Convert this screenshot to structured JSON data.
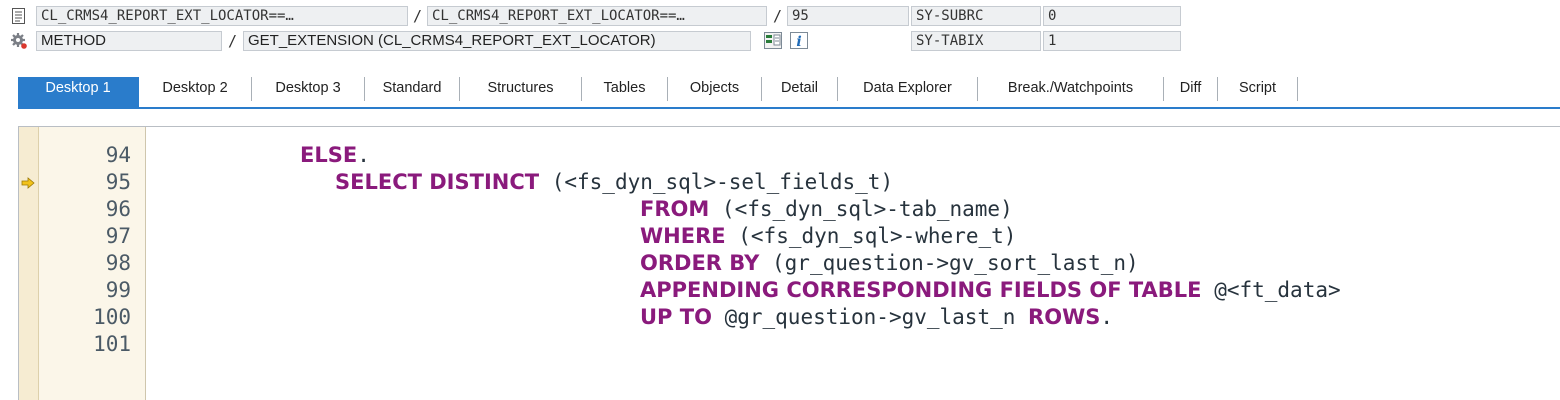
{
  "header": {
    "row1": {
      "program": "CL_CRMS4_REPORT_EXT_LOCATOR==…",
      "include": "CL_CRMS4_REPORT_EXT_LOCATOR==…",
      "line": "95",
      "sysvar_name": "SY-SUBRC",
      "sysvar_value": "0",
      "separator": "/"
    },
    "row2": {
      "event_type": "METHOD",
      "event": "GET_EXTENSION (CL_CRMS4_REPORT_EXT_LOCATOR)",
      "sysvar_name": "SY-TABIX",
      "sysvar_value": "1",
      "separator": "/"
    }
  },
  "tabs": [
    {
      "label": "Desktop 1",
      "active": true
    },
    {
      "label": "Desktop 2"
    },
    {
      "label": "Desktop 3"
    },
    {
      "label": "Standard"
    },
    {
      "label": "Structures"
    },
    {
      "label": "Tables"
    },
    {
      "label": "Objects"
    },
    {
      "label": "Detail"
    },
    {
      "label": "Data Explorer"
    },
    {
      "label": "Break./Watchpoints"
    },
    {
      "label": "Diff"
    },
    {
      "label": "Script"
    }
  ],
  "editor": {
    "current_line": "95",
    "lines": [
      {
        "no": "94",
        "kw1": "ELSE",
        "tail": "."
      },
      {
        "no": "95",
        "kw1": "SELECT DISTINCT",
        "text": "(<fs_dyn_sql>-sel_fields_t)"
      },
      {
        "no": "96",
        "kw1": "FROM",
        "text": "(<fs_dyn_sql>-tab_name)"
      },
      {
        "no": "97",
        "kw1": "WHERE",
        "text": "(<fs_dyn_sql>-where_t)"
      },
      {
        "no": "98",
        "kw1": "ORDER BY",
        "text": "(gr_question->gv_sort_last_n)"
      },
      {
        "no": "99",
        "kw1": "APPENDING CORRESPONDING FIELDS OF TABLE",
        "text": "@<ft_data>"
      },
      {
        "no": "100",
        "kw1": "UP TO",
        "text": "@gr_question->gv_last_n",
        "kw2": "ROWS",
        "tail": "."
      },
      {
        "no": "101"
      }
    ]
  }
}
